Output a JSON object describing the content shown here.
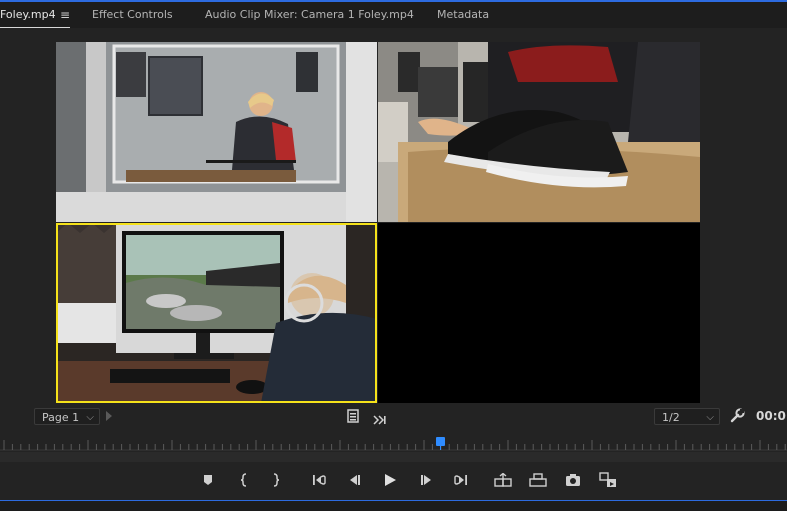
{
  "tabs": [
    {
      "label": "Foley.mp4",
      "active": true
    },
    {
      "label": "Effect Controls",
      "active": false
    },
    {
      "label": "Audio Clip Mixer: Camera 1 Foley.mp4",
      "active": false
    },
    {
      "label": "Metadata",
      "active": false
    }
  ],
  "tab_menu_icon": "hamburger-menu-icon",
  "program": {
    "cameras": [
      {
        "name": "camera-1",
        "description": "recording-booth-window"
      },
      {
        "name": "camera-2",
        "description": "sneaker-on-sand"
      },
      {
        "name": "camera-3",
        "description": "monitor-forest-scene",
        "selected": true
      },
      {
        "name": "camera-4",
        "description": "empty"
      }
    ],
    "selected_color": "#f5e21a"
  },
  "controls": {
    "page_select": "Page 1",
    "zoom_select": "1/2",
    "timecode": "00:0"
  },
  "transport": {
    "buttons": [
      "add-marker-icon",
      "mark-in-icon",
      "mark-out-icon",
      "go-to-in-icon",
      "step-back-icon",
      "play-icon",
      "step-forward-icon",
      "go-to-out-icon",
      "lift-icon",
      "extract-icon",
      "export-frame-icon",
      "toggle-multicam-icon"
    ]
  },
  "colors": {
    "accent_blue": "#2d6be0",
    "playhead": "#2f8cff",
    "selection_yellow": "#f5e21a"
  }
}
